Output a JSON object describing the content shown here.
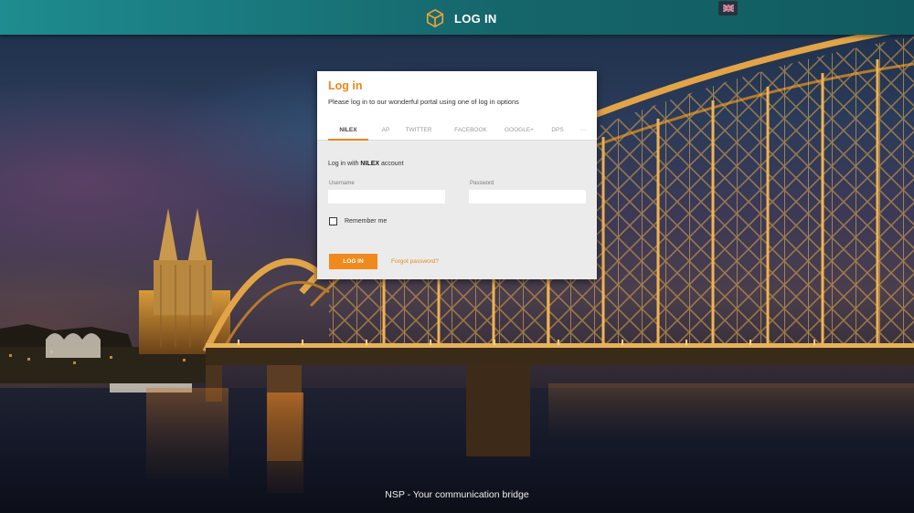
{
  "header": {
    "title": "LOG IN",
    "logo_icon": "cube-icon",
    "language_icon": "uk-flag-icon",
    "colors": {
      "bar_start": "#1e8c90",
      "bar_end": "#115b60"
    }
  },
  "login_card": {
    "title": "Log in",
    "subtitle": "Please log in to our wonderful portal using one of log in options",
    "tabs": [
      {
        "label": "NILEX",
        "active": true
      },
      {
        "label": "AP",
        "active": false
      },
      {
        "label": "TWITTER",
        "active": false
      },
      {
        "label": "FACEBOOK",
        "active": false
      },
      {
        "label": "GOOGLE+",
        "active": false
      },
      {
        "label": "DPS",
        "active": false
      },
      {
        "label": "···",
        "active": false
      }
    ],
    "account_prefix": "Log in with",
    "account_name": "NILEX",
    "account_suffix": "account",
    "username_label": "Username",
    "username_value": "",
    "password_label": "Password",
    "password_value": "",
    "remember_label": "Remember me",
    "remember_checked": false,
    "login_button": "LOG IN",
    "forgot_link": "Forgot password?",
    "colors": {
      "accent": "#e8891a",
      "button": "#f08a1d"
    }
  },
  "footer": {
    "tagline": "NSP - Your communication bridge"
  }
}
